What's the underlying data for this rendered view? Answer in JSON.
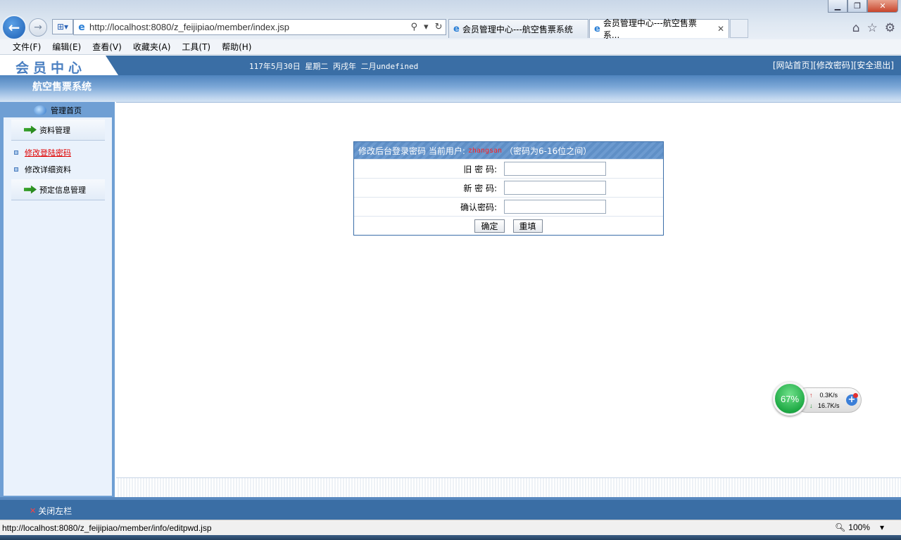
{
  "browser": {
    "url": "http://localhost:8080/z_feijipiao/member/index.jsp",
    "tabs": [
      {
        "label": "会员管理中心---航空售票系统"
      },
      {
        "label": "会员管理中心---航空售票系..."
      }
    ],
    "menu": [
      "文件(F)",
      "编辑(E)",
      "查看(V)",
      "收藏夹(A)",
      "工具(T)",
      "帮助(H)"
    ],
    "status_url": "http://localhost:8080/z_feijipiao/member/info/editpwd.jsp",
    "zoom": "100%"
  },
  "header": {
    "logo": "会员中心",
    "date": "117年5月30日 星期二 丙戌年 二月undefined",
    "links": [
      "[网站首页]",
      "[修改密码]",
      "[安全退出]"
    ],
    "system_title": "航空售票系统"
  },
  "sidebar": {
    "home": "管理首页",
    "groups": [
      {
        "label": "资料管理",
        "items": [
          "修改登陆密码",
          "修改详细资料"
        ]
      },
      {
        "label": "预定信息管理",
        "items": []
      }
    ],
    "close_left": "关闭左栏"
  },
  "form": {
    "title": "修改后台登录密码 当前用户:",
    "user": "zhangsan",
    "hint": "（密码为6-16位之间）",
    "fields": [
      {
        "label": "旧 密 码:",
        "value": ""
      },
      {
        "label": "新 密 码:",
        "value": ""
      },
      {
        "label": "确认密码:",
        "value": ""
      }
    ],
    "submit": "确定",
    "reset": "重填"
  },
  "net_widget": {
    "percent": "67%",
    "up": "0.3K/s",
    "down": "16.7K/s"
  }
}
